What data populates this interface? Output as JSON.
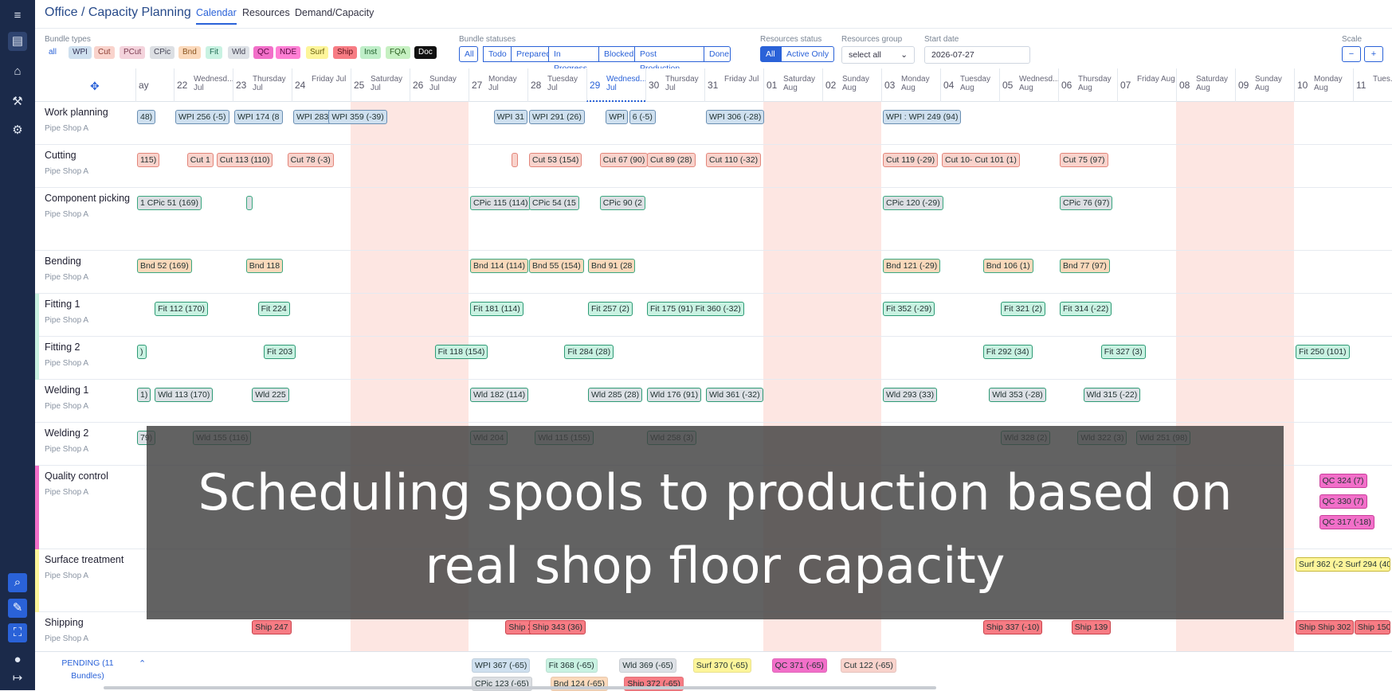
{
  "app": {
    "title": "Office / Capacity Planning"
  },
  "tabs": [
    {
      "label": "Calendar"
    },
    {
      "label": "Resources"
    },
    {
      "label": "Demand/Capacity"
    }
  ],
  "filters": {
    "bundle_types_label": "Bundle types",
    "bundle_types": [
      {
        "label": "all",
        "bg": "#ffffff",
        "fg": "#2a62d8"
      },
      {
        "label": "WPI",
        "bg": "#cfe0ef",
        "fg": "#335"
      },
      {
        "label": "Cut",
        "bg": "#f9d3cc",
        "fg": "#8a3b30"
      },
      {
        "label": "PCut",
        "bg": "#f4d3dc",
        "fg": "#7a3b50"
      },
      {
        "label": "CPic",
        "bg": "#dcdfe3",
        "fg": "#445"
      },
      {
        "label": "Bnd",
        "bg": "#fbd9bb",
        "fg": "#8a5420"
      },
      {
        "label": "Fit",
        "bg": "#c9f2e2",
        "fg": "#1e6a52"
      },
      {
        "label": "Wld",
        "bg": "#dde1e6",
        "fg": "#445"
      },
      {
        "label": "QC",
        "bg": "#f26fc9",
        "fg": "#5a0a45"
      },
      {
        "label": "NDE",
        "bg": "#ff7fd4",
        "fg": "#5a0a45"
      },
      {
        "label": "Surf",
        "bg": "#fdf59a",
        "fg": "#6a6010"
      },
      {
        "label": "Ship",
        "bg": "#f77c84",
        "fg": "#5a1018"
      },
      {
        "label": "Inst",
        "bg": "#bfeec8",
        "fg": "#1d5e2a"
      },
      {
        "label": "FQA",
        "bg": "#c6f0c2",
        "fg": "#2a5e20"
      },
      {
        "label": "Doc",
        "bg": "#111111",
        "fg": "#ffffff"
      }
    ],
    "bundle_statuses_label": "Bundle statuses",
    "bundle_statuses": [
      "All",
      "Todo",
      "Prepared",
      "In Progress",
      "Blocked",
      "Post Production",
      "Done"
    ],
    "resources_status_label": "Resources status",
    "resources_status": [
      "All",
      "Active Only"
    ],
    "resources_group_label": "Resources group",
    "resources_group_value": "select all",
    "start_date_label": "Start date",
    "start_date_value": "2026-07-27",
    "scale_label": "Scale"
  },
  "days": [
    {
      "num": "ay",
      "name": ""
    },
    {
      "num": "22",
      "name": "Wednesd... Jul"
    },
    {
      "num": "23",
      "name": "Thursday Jul"
    },
    {
      "num": "24",
      "name": "Friday Jul"
    },
    {
      "num": "25",
      "name": "Saturday Jul"
    },
    {
      "num": "26",
      "name": "Sunday Jul"
    },
    {
      "num": "27",
      "name": "Monday Jul"
    },
    {
      "num": "28",
      "name": "Tuesday Jul"
    },
    {
      "num": "29",
      "name": "Wednesd... Jul"
    },
    {
      "num": "30",
      "name": "Thursday Jul"
    },
    {
      "num": "31",
      "name": "Friday Jul"
    },
    {
      "num": "01",
      "name": "Saturday Aug"
    },
    {
      "num": "02",
      "name": "Sunday Aug"
    },
    {
      "num": "03",
      "name": "Monday Aug"
    },
    {
      "num": "04",
      "name": "Tuesday Aug"
    },
    {
      "num": "05",
      "name": "Wednesd... Aug"
    },
    {
      "num": "06",
      "name": "Thursday Aug"
    },
    {
      "num": "07",
      "name": "Friday Aug"
    },
    {
      "num": "08",
      "name": "Saturday Aug"
    },
    {
      "num": "09",
      "name": "Sunday Aug"
    },
    {
      "num": "10",
      "name": "Monday Aug"
    },
    {
      "num": "11",
      "name": "Tues..."
    }
  ],
  "rows": [
    {
      "name": "Work planning",
      "sub": "Pipe Shop A"
    },
    {
      "name": "Cutting",
      "sub": "Pipe Shop A"
    },
    {
      "name": "Component picking",
      "sub": "Pipe Shop A"
    },
    {
      "name": "Bending",
      "sub": "Pipe Shop A"
    },
    {
      "name": "Fitting 1",
      "sub": "Pipe Shop A"
    },
    {
      "name": "Fitting 2",
      "sub": "Pipe Shop A"
    },
    {
      "name": "Welding 1",
      "sub": "Pipe Shop A"
    },
    {
      "name": "Welding 2",
      "sub": "Pipe Shop A"
    },
    {
      "name": "Quality control",
      "sub": "Pipe Shop A"
    },
    {
      "name": "Surface treatment",
      "sub": "Pipe Shop A"
    },
    {
      "name": "Shipping",
      "sub": "Pipe Shop A"
    }
  ],
  "bars": [
    {
      "row": 0,
      "day": 0,
      "label": "48)"
    },
    {
      "row": 0,
      "day": 1,
      "label": "WPI 256 (-5)"
    },
    {
      "row": 0,
      "day": 2,
      "label": "WPI 174 (8"
    },
    {
      "row": 0,
      "day": 3,
      "label": "WPI 283"
    },
    {
      "row": 0,
      "day": 3.6,
      "label": "WPI 359 (-39)"
    },
    {
      "row": 0,
      "day": 6.4,
      "label": "WPI 31"
    },
    {
      "row": 0,
      "day": 7,
      "label": "WPI 291 (26)"
    },
    {
      "row": 0,
      "day": 8.3,
      "label": "WPI"
    },
    {
      "row": 0,
      "day": 8.7,
      "label": "6 (-5)"
    },
    {
      "row": 0,
      "day": 10,
      "label": "WPI 306 (-28)"
    },
    {
      "row": 0,
      "day": 13,
      "label": "WPI : WPI 249 (94)"
    },
    {
      "row": 1,
      "day": 0,
      "label": "115)"
    },
    {
      "row": 1,
      "day": 1.2,
      "label": "Cut 1"
    },
    {
      "row": 1,
      "day": 1.7,
      "label": "Cut 113 (110)"
    },
    {
      "row": 1,
      "day": 2.9,
      "label": "Cut 78 (-3)"
    },
    {
      "row": 1,
      "day": 6.7,
      "label": ""
    },
    {
      "row": 1,
      "day": 7,
      "label": "Cut 53 (154)"
    },
    {
      "row": 1,
      "day": 8.2,
      "label": "Cut 67 (90)"
    },
    {
      "row": 1,
      "day": 9,
      "label": "Cut 89 (28)"
    },
    {
      "row": 1,
      "day": 10,
      "label": "Cut 110 (-32)"
    },
    {
      "row": 1,
      "day": 13,
      "label": "Cut 119 (-29)"
    },
    {
      "row": 1,
      "day": 14,
      "label": "Cut 10- Cut 101 (1)"
    },
    {
      "row": 1,
      "day": 16,
      "label": "Cut 75 (97)"
    },
    {
      "row": 2,
      "day": 0,
      "label": "1 CPic 51 (169)"
    },
    {
      "row": 2,
      "day": 2.2,
      "label": ""
    },
    {
      "row": 2,
      "day": 6,
      "label": "CPic 115 (114)"
    },
    {
      "row": 2,
      "day": 7,
      "label": "CPic 54 (15"
    },
    {
      "row": 2,
      "day": 8.2,
      "label": "CPic 90 (2"
    },
    {
      "row": 2,
      "day": 13,
      "label": "CPic 120 (-29)"
    },
    {
      "row": 2,
      "day": 16,
      "label": "CPic 76 (97)"
    },
    {
      "row": 3,
      "day": 0,
      "label": "Bnd 52 (169)"
    },
    {
      "row": 3,
      "day": 2.2,
      "label": "Bnd 118"
    },
    {
      "row": 3,
      "day": 6,
      "label": "Bnd 114 (114)"
    },
    {
      "row": 3,
      "day": 7,
      "label": "Bnd 55 (154)"
    },
    {
      "row": 3,
      "day": 8,
      "label": "Bnd 91 (28"
    },
    {
      "row": 3,
      "day": 13,
      "label": "Bnd 121 (-29)"
    },
    {
      "row": 3,
      "day": 14.7,
      "label": "Bnd 106 (1)"
    },
    {
      "row": 3,
      "day": 16,
      "label": "Bnd 77 (97)"
    },
    {
      "row": 4,
      "day": 0.3,
      "label": "Fit 112 (170)"
    },
    {
      "row": 4,
      "day": 2.4,
      "label": "Fit 224"
    },
    {
      "row": 4,
      "day": 6,
      "label": "Fit 181 (114)"
    },
    {
      "row": 4,
      "day": 8,
      "label": "Fit 257 (2)"
    },
    {
      "row": 4,
      "day": 9,
      "label": "Fit 175 (91)  Fit 360 (-32)"
    },
    {
      "row": 4,
      "day": 13,
      "label": "Fit 352 (-29)"
    },
    {
      "row": 4,
      "day": 15,
      "label": "Fit 321 (2)"
    },
    {
      "row": 4,
      "day": 16,
      "label": "Fit 314 (-22)"
    },
    {
      "row": 5,
      "day": 0,
      "label": ")"
    },
    {
      "row": 5,
      "day": 2.5,
      "label": "Fit 203"
    },
    {
      "row": 5,
      "day": 5.4,
      "label": "Fit 118 (154)"
    },
    {
      "row": 5,
      "day": 7.6,
      "label": "Fit 284 (28)"
    },
    {
      "row": 5,
      "day": 14.7,
      "label": "Fit 292 (34)"
    },
    {
      "row": 5,
      "day": 16.7,
      "label": "Fit 327 (3)"
    },
    {
      "row": 5,
      "day": 20,
      "label": "Fit 250 (101)"
    },
    {
      "row": 6,
      "day": 0,
      "label": "1)"
    },
    {
      "row": 6,
      "day": 0.3,
      "label": "Wld 113 (170)"
    },
    {
      "row": 6,
      "day": 2.3,
      "label": "Wld 225"
    },
    {
      "row": 6,
      "day": 6,
      "label": "Wld 182 (114)"
    },
    {
      "row": 6,
      "day": 8,
      "label": "Wld 285 (28)"
    },
    {
      "row": 6,
      "day": 9,
      "label": "Wld 176 (91)"
    },
    {
      "row": 6,
      "day": 10,
      "label": "Wld 361 (-32)"
    },
    {
      "row": 6,
      "day": 13,
      "label": "Wld 293 (33)"
    },
    {
      "row": 6,
      "day": 14.8,
      "label": "Wld 353 (-28)"
    },
    {
      "row": 6,
      "day": 16.4,
      "label": "Wld 315 (-22)"
    },
    {
      "row": 7,
      "day": 0,
      "label": "79)"
    },
    {
      "row": 7,
      "day": 1.3,
      "label": "Wld 155 (116)"
    },
    {
      "row": 7,
      "day": 6,
      "label": "Wld 204"
    },
    {
      "row": 7,
      "day": 7.1,
      "label": "Wld 115 (155)"
    },
    {
      "row": 7,
      "day": 9,
      "label": "Wld 258 (3)"
    },
    {
      "row": 7,
      "day": 15,
      "label": "Wld 328 (2)"
    },
    {
      "row": 7,
      "day": 16.3,
      "label": "Wld 322 (3)"
    },
    {
      "row": 7,
      "day": 17.3,
      "label": "Wld 251 (98)"
    },
    {
      "row": 8,
      "day": 20.4,
      "label": "QC 324 (7)"
    },
    {
      "row": 9,
      "day": 20,
      "label": "Surf 362 (-2 Surf 294 (40"
    },
    {
      "row": 10,
      "day": 2.3,
      "label": "Ship 247"
    },
    {
      "row": 10,
      "day": 6.6,
      "label": "Ship 2"
    },
    {
      "row": 10,
      "day": 7,
      "label": "Ship 343 (36)"
    },
    {
      "row": 10,
      "day": 14.7,
      "label": "Ship 337 (-10)"
    },
    {
      "row": 10,
      "day": 16.2,
      "label": "Ship 139"
    },
    {
      "row": 10,
      "day": 20,
      "label": "Ship Ship 302"
    },
    {
      "row": 10,
      "day": 21,
      "label": "Ship 150"
    }
  ],
  "qc_extra": [
    {
      "label": "QC 330 (7)"
    },
    {
      "label": "QC 317 (-18)"
    }
  ],
  "pending": {
    "label": "PENDING (11 Bundles)",
    "items": [
      {
        "label": "WPI 367 (-65)",
        "bg": "#cfe0ef"
      },
      {
        "label": "Fit 368 (-65)",
        "bg": "#c9f2e2"
      },
      {
        "label": "Wld 369 (-65)",
        "bg": "#dde1e6"
      },
      {
        "label": "Surf 370 (-65)",
        "bg": "#fdf59a"
      },
      {
        "label": "QC 371 (-65)",
        "bg": "#f26fc9"
      },
      {
        "label": "Cut 122 (-65)",
        "bg": "#f9d3cc"
      },
      {
        "label": "CPic 123 (-65)",
        "bg": "#dcdfe3"
      },
      {
        "label": "Bnd 124 (-65)",
        "bg": "#fbd9bb"
      },
      {
        "label": "Ship 372 (-65)",
        "bg": "#f77c84"
      }
    ]
  },
  "overlay": {
    "line1": "Scheduling spools to production based on",
    "line2": "real shop floor capacity"
  }
}
